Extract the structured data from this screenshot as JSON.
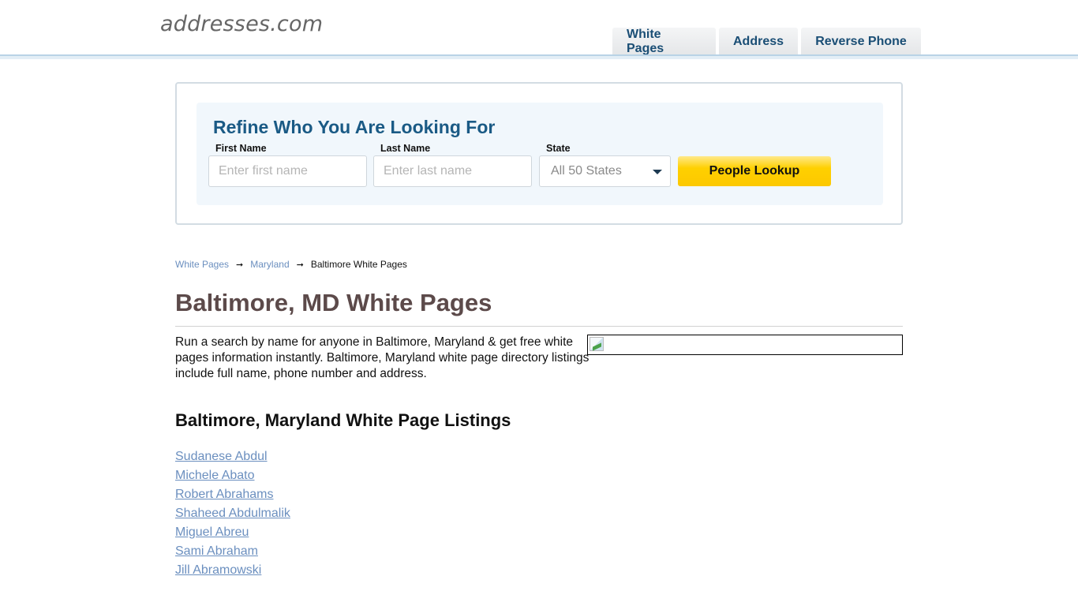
{
  "header": {
    "logo": "addresses.com",
    "tabs": [
      {
        "label": "White Pages"
      },
      {
        "label": "Address"
      },
      {
        "label": "Reverse Phone"
      }
    ]
  },
  "search": {
    "title": "Refine Who You Are Looking For",
    "first_name": {
      "label": "First Name",
      "placeholder": "Enter first name",
      "value": ""
    },
    "last_name": {
      "label": "Last Name",
      "placeholder": "Enter last name",
      "value": ""
    },
    "state": {
      "label": "State",
      "selected": "All 50 States"
    },
    "button_label": "People Lookup"
  },
  "breadcrumb": {
    "items": [
      {
        "label": "White Pages"
      },
      {
        "label": "Maryland"
      }
    ],
    "current": "Baltimore White Pages",
    "separator_icon": "arrow-right-icon"
  },
  "main": {
    "title": "Baltimore, MD White Pages",
    "intro": "Run a search by name for anyone in Baltimore, Maryland & get free white pages information instantly. Baltimore, Maryland white page directory listings include full name, phone number and address.",
    "ad_image_icon": "broken-image-icon",
    "listings_title": "Baltimore, Maryland White Page Listings",
    "listings": [
      "Sudanese Abdul",
      "Michele Abato",
      "Robert Abrahams",
      "Shaheed Abdulmalik",
      "Miguel Abreu",
      "Sami Abraham",
      "Jill Abramowski"
    ]
  },
  "colors": {
    "brand_blue": "#1a5a85",
    "tab_text": "#1a4e75",
    "link": "#6b8fbf",
    "heading": "#5c4a4a",
    "button_yellow": "#ffd000"
  }
}
